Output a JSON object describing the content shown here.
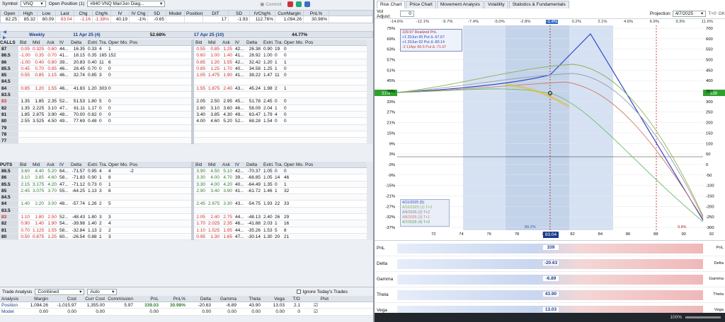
{
  "toolbar": {
    "symbol_label": "Symbol",
    "symbol": "VNQ",
    "open_pos_label": "Open Position (1)",
    "position_select": "#840 VNQ Mar/Jun Diag...",
    "commit": "Commit"
  },
  "quote": {
    "headers": [
      "Open",
      "High",
      "Low",
      "Last",
      "Chg",
      "Chg%",
      "IV",
      "IV Chg",
      "SD",
      "Model",
      "Position",
      "DIT",
      "SD",
      "IVChg%",
      "CurrMargin",
      "PnL%"
    ],
    "values": [
      "82.25",
      "85.32",
      "80.09",
      "83.04",
      "-1.16",
      "-1.38%",
      "40.19",
      "-1%",
      "-0.65",
      "",
      "",
      "17",
      "-1.93",
      "112.76%",
      "1,094.26",
      "30.98%"
    ]
  },
  "calls": {
    "label": "CALLS",
    "exp1": "Weekly",
    "exp1_date": "11 Apr 25 (4)",
    "exp1_iv": "52.68%",
    "exp2_date": "17 Apr 25 (10)",
    "exp2_iv": "44.77%",
    "cols": [
      "Bid",
      "Mid",
      "Ask",
      "IV",
      "Delta",
      "Extri...",
      "Tra...",
      "Open...",
      "Mo...",
      "Pos"
    ],
    "strikes": [
      "87",
      "86.5",
      "86",
      "85.5",
      "85",
      "84.5",
      "84",
      "83.5",
      "83",
      "82",
      "81",
      "80",
      "79",
      "78",
      "77"
    ],
    "left": [
      [
        "0.05",
        "0.325",
        "0.60",
        "44...",
        "16.35",
        "0.33",
        "4",
        "1",
        "",
        ""
      ],
      [
        "-1.00",
        "0.35",
        "0.70",
        "41...",
        "18.15",
        "0.35",
        "165",
        "152",
        "",
        ""
      ],
      [
        "-1.00",
        "0.40",
        "0.80",
        "39...",
        "20.83",
        "0.40",
        "11",
        "6",
        "",
        ""
      ],
      [
        "0.45",
        "0.70",
        "0.95",
        "46...",
        "28.45",
        "0.70",
        "0",
        "0",
        "",
        ""
      ],
      [
        "0.55",
        "0.85",
        "1.15",
        "46...",
        "32.74",
        "0.85",
        "3",
        "0",
        "",
        ""
      ],
      [
        "",
        "",
        "",
        "",
        "",
        "",
        "",
        "",
        "",
        ""
      ],
      [
        "0.85",
        "1.20",
        "1.55",
        "46...",
        "41.83",
        "1.20",
        "303",
        "0",
        "",
        ""
      ],
      [
        "",
        "",
        "",
        "",
        "",
        "",
        "",
        "",
        "",
        ""
      ],
      [
        "1.35",
        "1.85",
        "2.35",
        "52...",
        "51.53",
        "1.80",
        "5",
        "0",
        "",
        ""
      ],
      [
        "1.35",
        "2.225",
        "3.10",
        "47...",
        "61.11",
        "1.17",
        "0",
        "0",
        "",
        ""
      ],
      [
        "1.85",
        "2.875",
        "3.90",
        "48...",
        "70.00",
        "0.82",
        "0",
        "0",
        "",
        ""
      ],
      [
        "2.55",
        "3.525",
        "4.50",
        "49...",
        "77.69",
        "0.48",
        "0",
        "0",
        "",
        ""
      ],
      [
        "",
        "",
        "",
        "",
        "",
        "",
        "",
        "",
        "",
        ""
      ],
      [
        "",
        "",
        "",
        "",
        "",
        "",
        "",
        "",
        "",
        ""
      ],
      [
        "",
        "",
        "",
        "",
        "",
        "",
        "",
        "",
        "",
        ""
      ]
    ],
    "right": [
      [
        "0.55",
        "0.85",
        "1.25",
        "42...",
        "26.38",
        "0.90",
        "19",
        "0",
        "",
        ""
      ],
      [
        "0.60",
        "1.00",
        "1.40",
        "41...",
        "28.92",
        "1.00",
        "0",
        "0",
        "",
        ""
      ],
      [
        "0.85",
        "1.20",
        "1.55",
        "42...",
        "32.42",
        "1.20",
        "1",
        "1",
        "",
        ""
      ],
      [
        "0.85",
        "1.25",
        "1.70",
        "40...",
        "34.58",
        "1.25",
        "1",
        "0",
        "",
        ""
      ],
      [
        "1.05",
        "1.475",
        "1.90",
        "41...",
        "38.22",
        "1.47",
        "11",
        "0",
        "",
        ""
      ],
      [
        "",
        "",
        "",
        "",
        "",
        "",
        "",
        "",
        "",
        ""
      ],
      [
        "1.55",
        "1.875",
        "2.40",
        "43...",
        "45.24",
        "1.98",
        "2",
        "1",
        "",
        ""
      ],
      [
        "",
        "",
        "",
        "",
        "",
        "",
        "",
        "",
        "",
        ""
      ],
      [
        "2.05",
        "2.50",
        "2.95",
        "45...",
        "51.78",
        "2.45",
        "0",
        "0",
        "",
        ""
      ],
      [
        "2.60",
        "3.10",
        "3.60",
        "46...",
        "58.09",
        "2.04",
        "1",
        "0",
        "",
        ""
      ],
      [
        "3.40",
        "3.85",
        "4.30",
        "49...",
        "63.47",
        "1.79",
        "4",
        "0",
        "",
        ""
      ],
      [
        "4.00",
        "4.60",
        "5.20",
        "52...",
        "68.28",
        "1.54",
        "0",
        "0",
        "",
        ""
      ],
      [
        "",
        "",
        "",
        "",
        "",
        "",
        "",
        "",
        "",
        ""
      ],
      [
        "",
        "",
        "",
        "",
        "",
        "",
        "",
        "",
        "",
        ""
      ],
      [
        "",
        "",
        "",
        "",
        "",
        "",
        "",
        "",
        "",
        ""
      ]
    ]
  },
  "puts": {
    "label": "PUTS",
    "strikes": [
      "86.5",
      "86",
      "85.5",
      "85",
      "84.5",
      "84",
      "83.5",
      "83",
      "82",
      "81",
      "80"
    ],
    "left": [
      [
        "3.60",
        "4.40",
        "5.20",
        "64...",
        "-71.57",
        "0.95",
        "4",
        "4",
        "",
        "-2"
      ],
      [
        "3.10",
        "3.85",
        "4.60",
        "58...",
        "-71.83",
        "0.90",
        "1",
        "8",
        "",
        ""
      ],
      [
        "2.15",
        "3.175",
        "4.20",
        "47...",
        "-71.12",
        "0.73",
        "0",
        "1",
        "",
        ""
      ],
      [
        "2.45",
        "3.075",
        "3.70",
        "55...",
        "-64.25",
        "1.13",
        "3",
        "8",
        "",
        ""
      ],
      [
        "",
        "",
        "",
        "",
        "",
        "",
        "",
        "",
        "",
        ""
      ],
      [
        "1.40",
        "2.20",
        "3.00",
        "48...",
        "-57.74",
        "1.26",
        "2",
        "5",
        "",
        ""
      ],
      [
        "",
        "",
        "",
        "",
        "",
        "",
        "",
        "",
        "",
        ""
      ],
      [
        "1.10",
        "1.80",
        "2.50",
        "52...",
        "-48.43",
        "1.80",
        "3",
        "3",
        "",
        ""
      ],
      [
        "0.90",
        "1.40",
        "1.90",
        "54...",
        "-39.98",
        "1.40",
        "2",
        "4",
        "",
        ""
      ],
      [
        "0.70",
        "1.125",
        "1.55",
        "58...",
        "-32.84",
        "1.13",
        "2",
        "2",
        "",
        ""
      ],
      [
        "0.50",
        "0.875",
        "1.25",
        "60...",
        "-26.54",
        "0.88",
        "1",
        "3",
        "",
        ""
      ]
    ],
    "right": [
      [
        "3.90",
        "4.50",
        "5.10",
        "42...",
        "-70.37",
        "1.05",
        "0",
        "0",
        "",
        ""
      ],
      [
        "3.30",
        "4.00",
        "4.70",
        "39...",
        "-68.85",
        "1.05",
        "14",
        "46",
        "",
        ""
      ],
      [
        "3.30",
        "4.00",
        "4.20",
        "40...",
        "-64.49",
        "1.35",
        "0",
        "1",
        "",
        ""
      ],
      [
        "2.90",
        "3.40",
        "3.90",
        "41...",
        "-61.72",
        "1.46",
        "1",
        "32",
        "",
        ""
      ],
      [
        "",
        "",
        "",
        "",
        "",
        "",
        "",
        "",
        "",
        ""
      ],
      [
        "2.45",
        "2.875",
        "3.30",
        "43...",
        "-54.75",
        "1.93",
        "22",
        "33",
        "",
        ""
      ],
      [
        "",
        "",
        "",
        "",
        "",
        "",
        "",
        "",
        "",
        ""
      ],
      [
        "2.05",
        "2.40",
        "2.75",
        "44...",
        "-48.13",
        "2.40",
        "26",
        "29",
        "",
        ""
      ],
      [
        "1.70",
        "2.025",
        "2.35",
        "46...",
        "-41.88",
        "2.03",
        "1",
        "16",
        "",
        ""
      ],
      [
        "1.10",
        "1.525",
        "1.95",
        "44...",
        "-35.26",
        "1.53",
        "5",
        "8",
        "",
        ""
      ],
      [
        "0.95",
        "1.30",
        "1.65",
        "47...",
        "-30.14",
        "1.30",
        "20",
        "21",
        "",
        ""
      ]
    ]
  },
  "trade_analysis": {
    "label": "Trade Analysis",
    "mode": "Combined",
    "auto": "Auto",
    "ignore": "Ignore Today's Trades",
    "cols": [
      "Analysis",
      "Margin",
      "Cost",
      "Curr Cost",
      "Commission",
      "PnL",
      "PnL%",
      "Delta",
      "Gamma",
      "Theta",
      "Vega",
      "T/D",
      "Plot"
    ],
    "rows": [
      {
        "name": "Position",
        "vals": [
          "1,094.26",
          "-1,015.97",
          "1,355.00",
          "5.97",
          "339.03",
          "30.98%",
          "-20.63",
          "-6.89",
          "43.90",
          "13.03",
          "2.1"
        ]
      },
      {
        "name": "Model",
        "vals": [
          "0.00",
          "0.00",
          "0.00",
          "",
          "0.00",
          "",
          "0.00",
          "0.00",
          "0.00",
          "0.00",
          "0"
        ]
      }
    ]
  },
  "right_panel": {
    "tabs": [
      "Risk Chart",
      "Price Chart",
      "Movement Analysis",
      "Volatility",
      "Statistics & Fundamentals"
    ],
    "vol_adjust_label": "Vol Adjust:",
    "vol_adjust": "0",
    "projection_label": "Projection",
    "projection": "4/7/2025",
    "t0": "T+0",
    "gk": "GK",
    "pct_ticks": [
      "-14.6%",
      "-12.1%",
      "-9.7%",
      "-7.4%",
      "-5.0%",
      "-2.8%",
      "-1.4%",
      "0.2%",
      "2.1%",
      "4.6%",
      "6.9%",
      "9.3%",
      "11.6%"
    ],
    "legend": [
      "109.97 Realized PnL",
      "+1 20Jun 95 Put Δ  -67.67",
      "+1 20Jun 92 Put Δ  -80.14",
      "-2 11Apr 86.5 Put Δ  -71.67"
    ],
    "dates": [
      "4/11/2025 (5)",
      "4/10/2025 (1) T+3",
      "4/9/2025 (2) T+2",
      "4/8/2025 (3) T+1",
      "4/7/2025 (4) T+0"
    ],
    "left_pct": [
      "75%",
      "69%",
      "63%",
      "57%",
      "51%",
      "45%",
      "39%",
      "33%",
      "27%",
      "21%",
      "15%",
      "9%",
      "3%",
      "-3%",
      "-9%",
      "-15%",
      "-21%",
      "-27%",
      "-32%",
      "-37%"
    ],
    "right_val": [
      "700",
      "600",
      "550",
      "500",
      "450",
      "400",
      "350",
      "300",
      "250",
      "200",
      "150",
      "100",
      "50",
      "0",
      "-50",
      "-100",
      "-150",
      "-200",
      "-250",
      "-300"
    ],
    "marker_left": "31%",
    "marker_right": "339",
    "x_ticks": [
      "72",
      "74",
      "76",
      "78",
      "80",
      "82",
      "84",
      "86",
      "88",
      "90",
      "92",
      "94"
    ],
    "current_price": "83.04",
    "band_low": "89.2%",
    "band_high": "9.8%",
    "greeks_labels": [
      "PnL",
      "Delta",
      "Gamma",
      "Theta",
      "Vega"
    ],
    "greek_center": [
      "339",
      "-20.63",
      "-6.89",
      "43.90",
      "13.03"
    ],
    "pnl_center_pct": "31.0%",
    "zoom": "100%"
  }
}
